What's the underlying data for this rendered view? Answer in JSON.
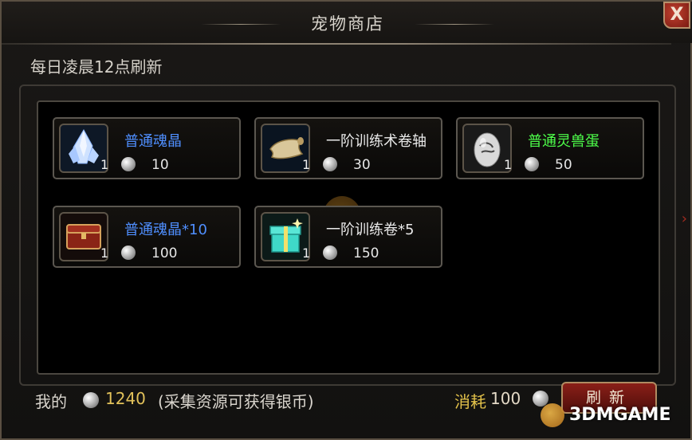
{
  "window": {
    "title": "宠物商店",
    "close_label": "X"
  },
  "refresh_note": "每日凌晨12点刷新",
  "items": [
    {
      "name": "普通魂晶",
      "qty": "1",
      "price": "10",
      "icon": "crystal-icon"
    },
    {
      "name": "一阶训练术卷轴",
      "qty": "1",
      "price": "30",
      "icon": "scroll-icon"
    },
    {
      "name": "普通灵兽蛋",
      "qty": "1",
      "price": "50",
      "icon": "egg-icon"
    },
    {
      "name": "普通魂晶*10",
      "qty": "1",
      "price": "100",
      "icon": "chest-icon"
    },
    {
      "name": "一阶训练卷*5",
      "qty": "1",
      "price": "150",
      "icon": "gift-box-icon"
    }
  ],
  "footer": {
    "my_label": "我的",
    "silver_amount": "1240",
    "silver_note": "(采集资源可获得银币)",
    "cost_label": "消耗",
    "cost_value": "100",
    "refresh_button": "刷新"
  },
  "watermark": "3DMGAME",
  "colors": {
    "name_blue": "#4f8fff",
    "name_white": "#e9e9e9",
    "name_green": "#4dff4a",
    "silver_amount": "#e2c25a",
    "cost_label": "#e3c24a",
    "button_red": "#8a1f18"
  }
}
